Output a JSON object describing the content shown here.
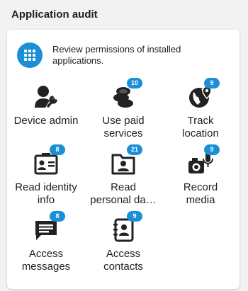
{
  "header": {
    "title": "Application audit"
  },
  "intro": {
    "icon": "apps-grid-icon",
    "line1": "Review permissions of installed",
    "line2": "applications."
  },
  "colors": {
    "accent": "#1b8fd6",
    "icon": "#222222"
  },
  "tiles": [
    {
      "label1": "Device admin",
      "label2": "",
      "badge": "",
      "icon": "device-admin-icon"
    },
    {
      "label1": "Use paid",
      "label2": "services",
      "badge": "10",
      "icon": "coins-icon"
    },
    {
      "label1": "Track",
      "label2": "location",
      "badge": "9",
      "icon": "globe-location-icon"
    },
    {
      "label1": "Read identity",
      "label2": "info",
      "badge": "8",
      "icon": "id-card-icon"
    },
    {
      "label1": "Read",
      "label2": "personal da…",
      "badge": "21",
      "icon": "personal-folder-icon"
    },
    {
      "label1": "Record",
      "label2": "media",
      "badge": "9",
      "icon": "camera-mic-icon"
    },
    {
      "label1": "Access",
      "label2": "messages",
      "badge": "8",
      "icon": "message-icon"
    },
    {
      "label1": "Access",
      "label2": "contacts",
      "badge": "9",
      "icon": "contacts-book-icon"
    }
  ]
}
